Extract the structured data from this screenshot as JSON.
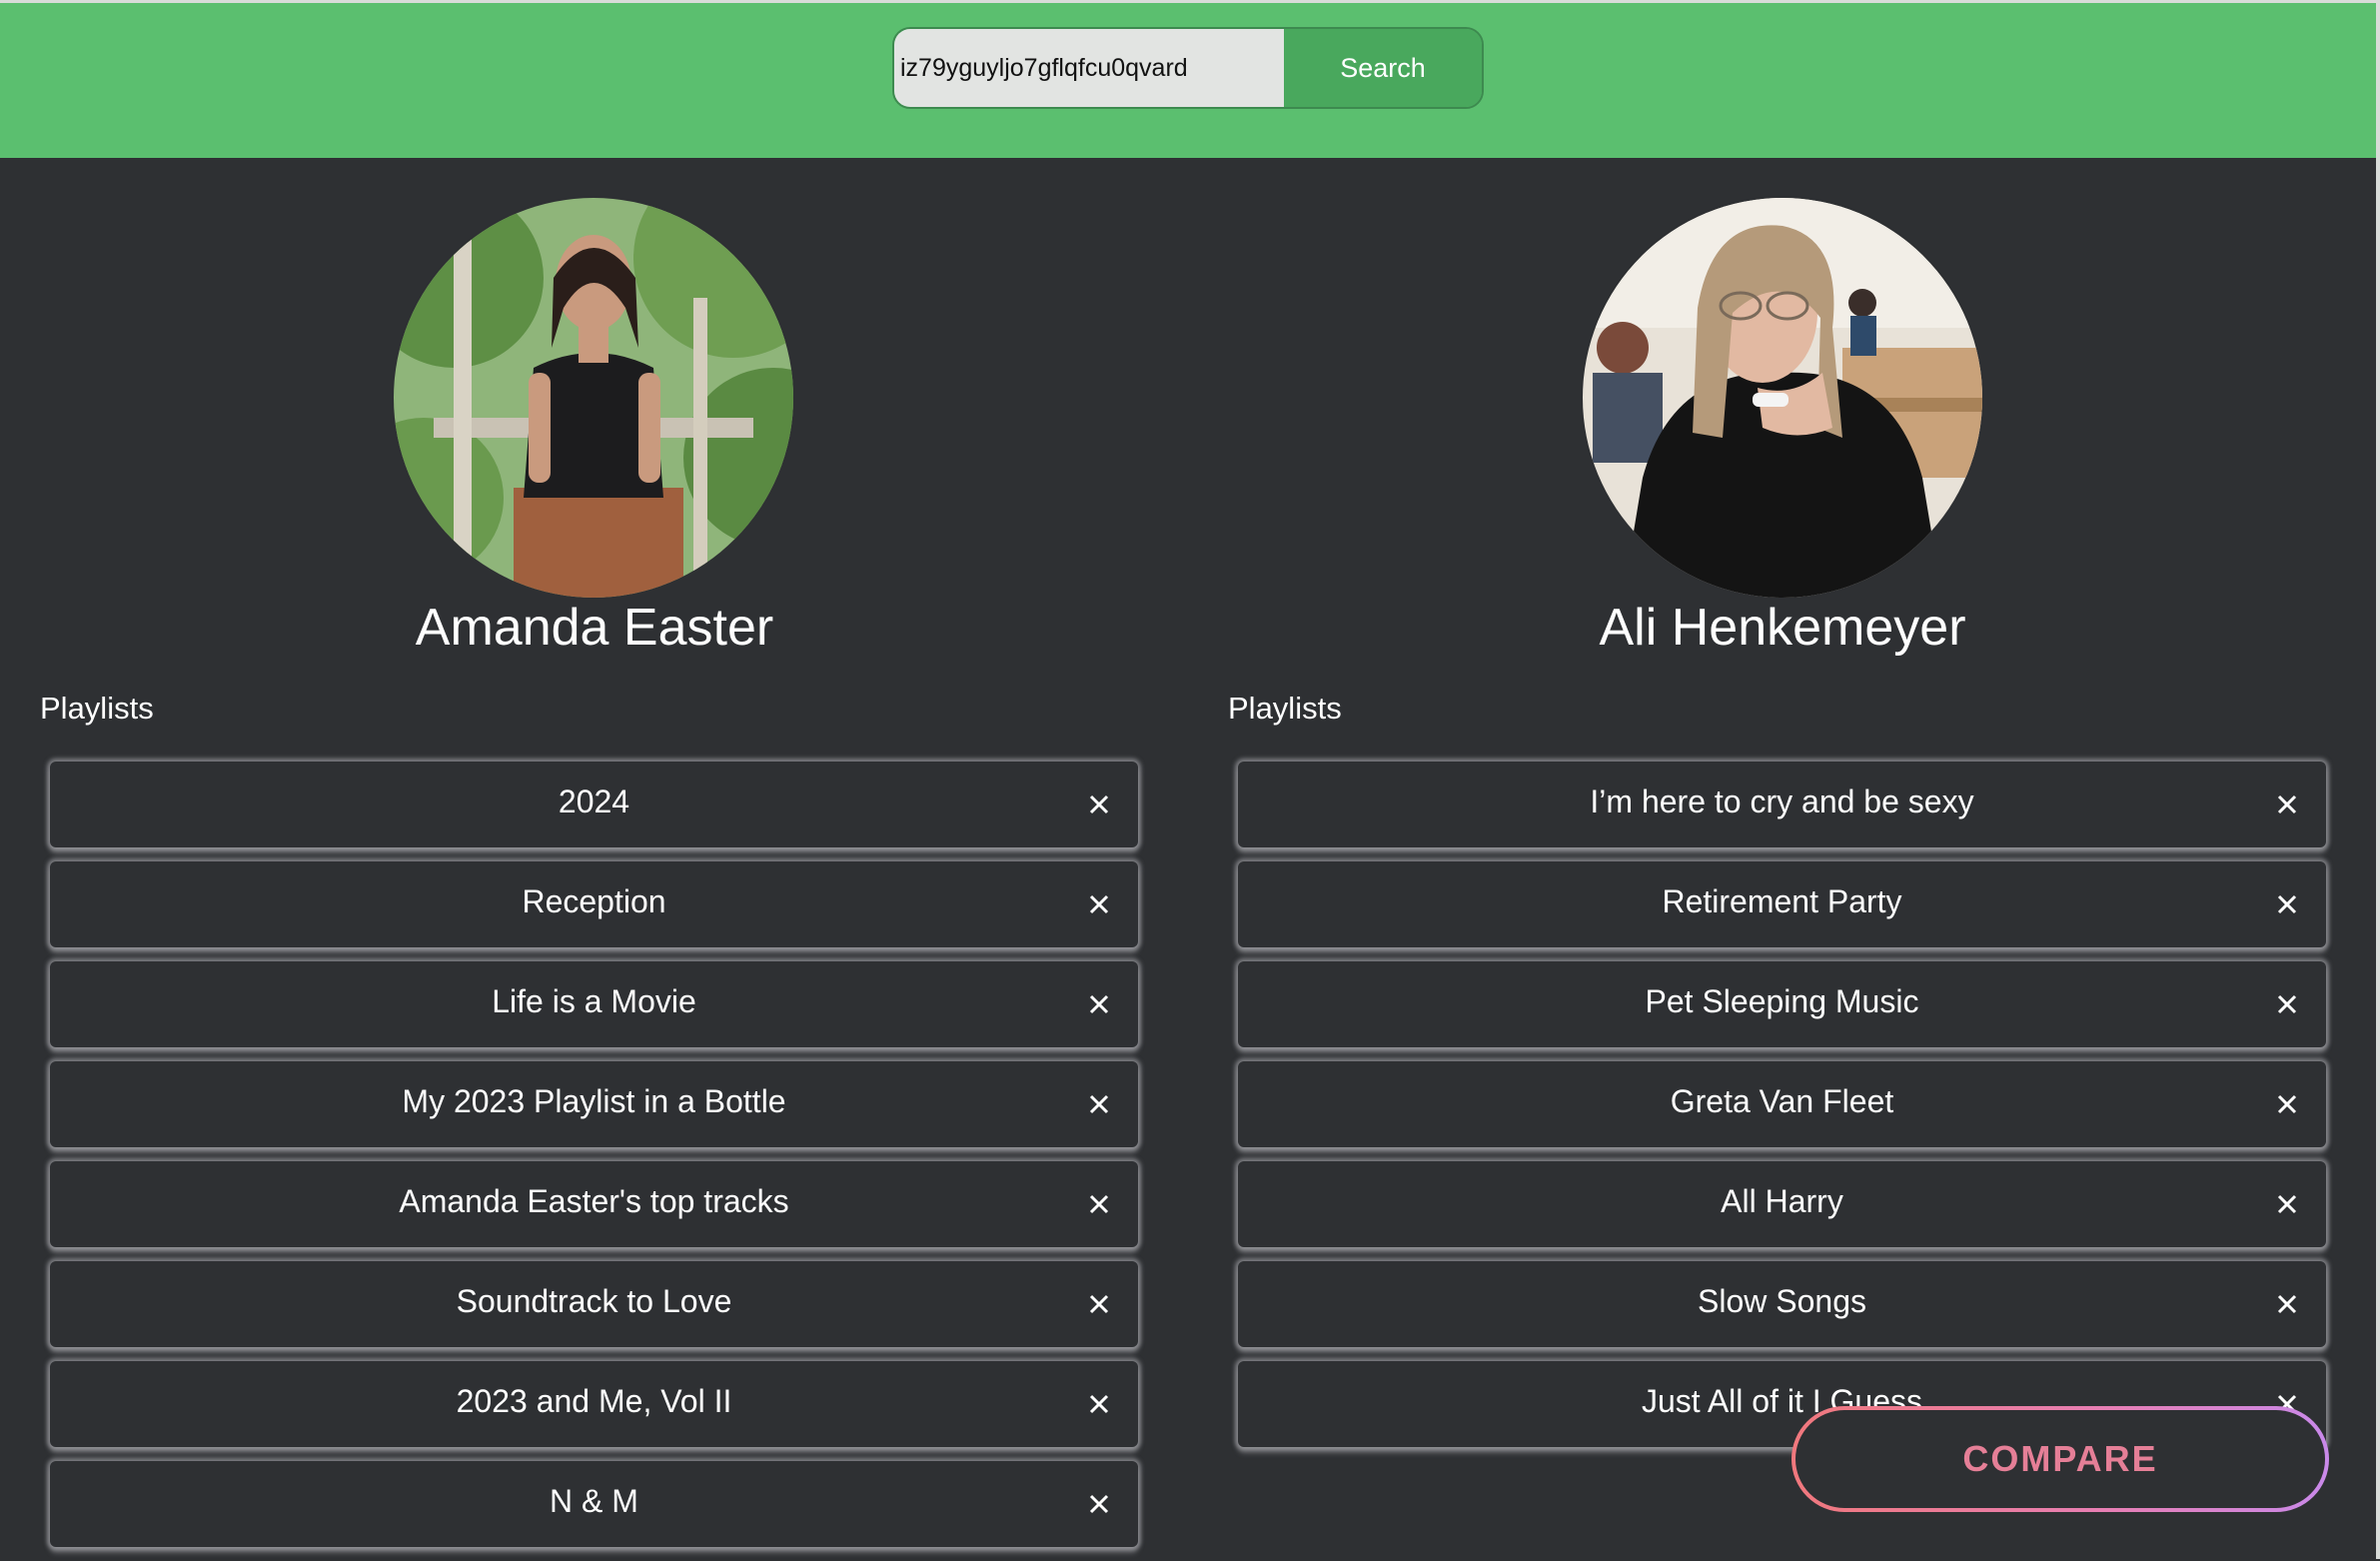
{
  "search": {
    "value": "iz79yguyljo7gflqfcu0qvard",
    "button_label": "Search"
  },
  "users": [
    {
      "name": "Amanda Easter",
      "playlists_label": "Playlists",
      "playlists": [
        "2024",
        "Reception",
        "Life is a Movie",
        "My 2023 Playlist in a Bottle",
        "Amanda Easter's top tracks",
        "Soundtrack to Love",
        "2023 and Me, Vol II",
        "N & M"
      ]
    },
    {
      "name": "Ali Henkemeyer",
      "playlists_label": "Playlists",
      "playlists": [
        "I’m here to cry and be sexy",
        "Retirement Party",
        "Pet Sleeping Music",
        "Greta Van Fleet",
        "All Harry",
        "Slow Songs",
        "Just All of it I Guess"
      ]
    }
  ],
  "compare_label": "COMPARE",
  "colors": {
    "header": "#5bbf6f",
    "background": "#2e3033",
    "search_button": "#49a85d",
    "compare_gradient_start": "#f0787d",
    "compare_gradient_end": "#c989ea"
  },
  "icons": {
    "remove": "close-icon",
    "avatar": "user-photo"
  }
}
